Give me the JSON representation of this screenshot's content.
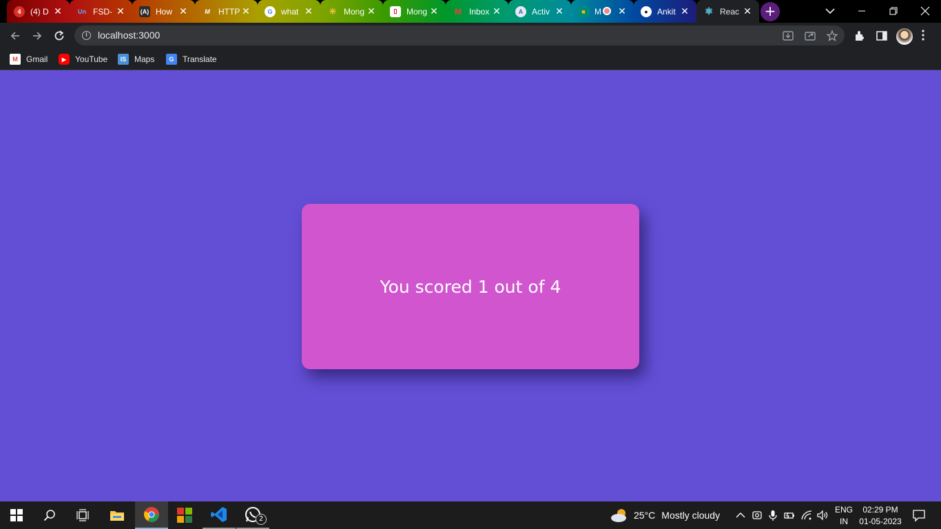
{
  "browser": {
    "tabs": [
      {
        "title": "(4) D",
        "icon": "notification-badge-icon",
        "color": "#d93025",
        "glyph": "4"
      },
      {
        "title": "FSD-",
        "icon": "unacademy-icon",
        "color": "#1a73e8",
        "glyph": "Un"
      },
      {
        "title": "How",
        "icon": "code-icon",
        "color": "#2b2b2b",
        "glyph": "(A)"
      },
      {
        "title": "HTTP",
        "icon": "medium-icon",
        "color": "#2b2b2b",
        "glyph": "M"
      },
      {
        "title": "what",
        "icon": "google-icon",
        "color": "#ffffff",
        "glyph": "G"
      },
      {
        "title": "Mong",
        "icon": "sparkle-icon",
        "color": "#2a8a3a",
        "glyph": "✳"
      },
      {
        "title": "Mong",
        "icon": "bookmark-page-icon",
        "color": "#ffffff",
        "glyph": "▯"
      },
      {
        "title": "Inbox",
        "icon": "gmail-icon",
        "color": "#ea4335",
        "glyph": "M"
      },
      {
        "title": "Activ",
        "icon": "atlas-icon",
        "color": "#5f6368",
        "glyph": "A"
      },
      {
        "title": "M",
        "icon": "meet-icon",
        "color": "#00897b",
        "glyph": "■"
      },
      {
        "title": "Ankit",
        "icon": "github-icon",
        "color": "#ffffff",
        "glyph": "●"
      },
      {
        "title": "Reac",
        "icon": "react-icon",
        "color": "#61dafb",
        "glyph": "⚛"
      }
    ],
    "new_tab_label": "+",
    "url": "localhost:3000",
    "bookmarks": [
      {
        "label": "Gmail",
        "icon": "gmail-icon",
        "color": "#ea4335",
        "glyph": "M"
      },
      {
        "label": "YouTube",
        "icon": "youtube-icon",
        "color": "#ff0000",
        "glyph": "▶"
      },
      {
        "label": "Maps",
        "icon": "maps-icon",
        "color": "#4a8fd8",
        "glyph": "IS"
      },
      {
        "label": "Translate",
        "icon": "translate-icon",
        "color": "#4285f4",
        "glyph": "G"
      }
    ]
  },
  "page": {
    "background": "#634fd6",
    "card_color": "#d055ce",
    "score_text": "You scored 1 out of 4"
  },
  "taskbar": {
    "weather_temp": "25°C",
    "weather_condition": "Mostly cloudy",
    "language_line1": "ENG",
    "language_line2": "IN",
    "time": "02:29 PM",
    "date": "01-05-2023",
    "whatsapp_badge": "2"
  }
}
